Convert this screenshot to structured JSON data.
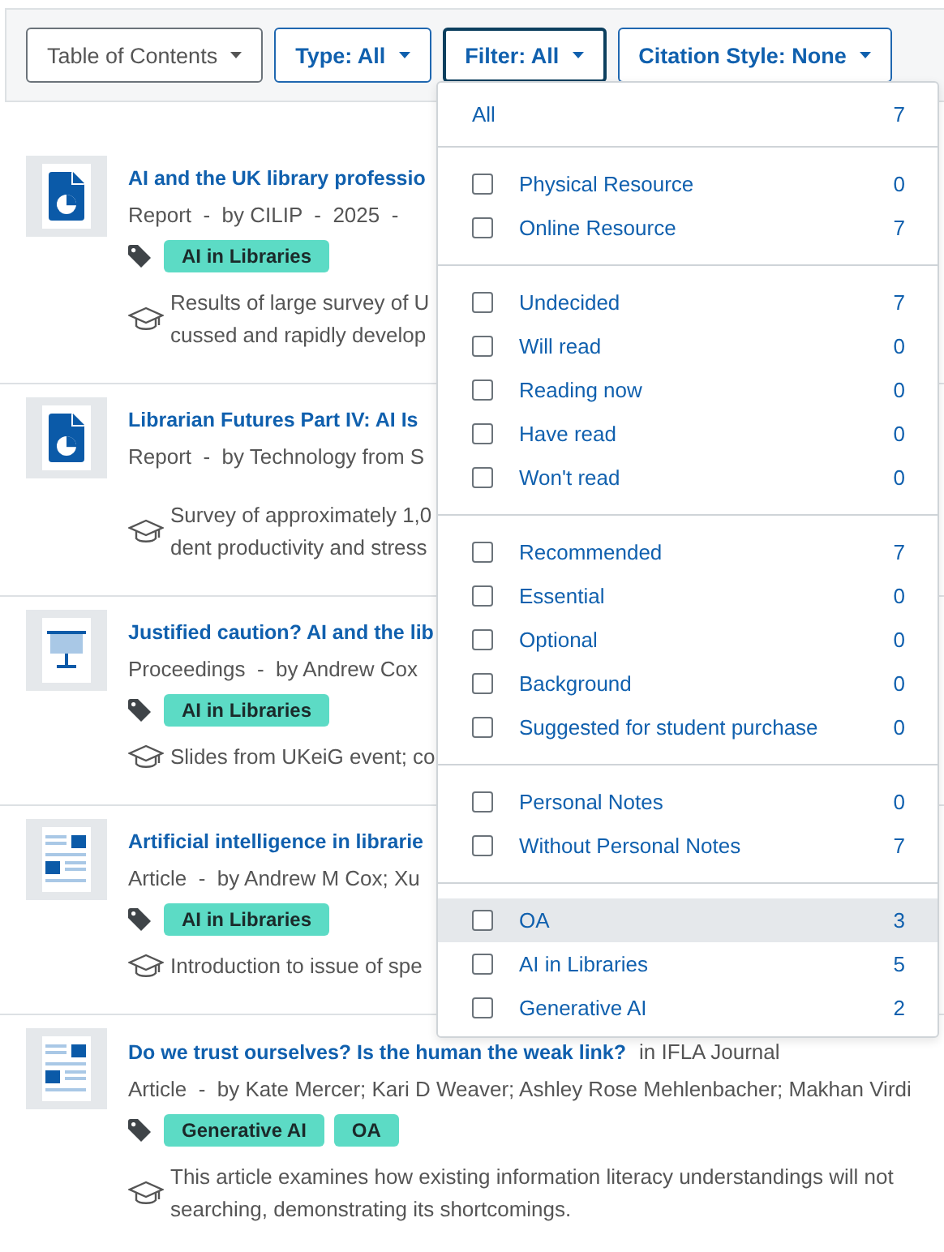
{
  "toolbar": {
    "buttons": [
      {
        "label": "Table of Contents",
        "kind": "plain",
        "open": false
      },
      {
        "label": "Type: All",
        "kind": "primary",
        "open": false
      },
      {
        "label": "Filter: All",
        "kind": "primary",
        "open": true
      },
      {
        "label": "Citation Style: None",
        "kind": "primary",
        "open": false
      }
    ]
  },
  "items": [
    {
      "kind": "report",
      "title": "AI and the UK library professio",
      "meta": "Report  -  by CILIP  -  2025  -",
      "tags": [
        {
          "label": "AI in Libraries"
        }
      ],
      "description": [
        "Results of large survey of U",
        "cussed and rapidly develop"
      ]
    },
    {
      "kind": "report",
      "title": "Librarian Futures Part IV: AI Is",
      "meta": "Report  -  by Technology from S",
      "description": [
        "Survey of approximately 1,0",
        "dent productivity and stress"
      ]
    },
    {
      "kind": "proceedings",
      "title": "Justified caution? AI and the lib",
      "meta": "Proceedings  -  by Andrew Cox",
      "tags": [
        {
          "label": "AI in Libraries"
        }
      ],
      "description": [
        "Slides from UKeiG event; co"
      ]
    },
    {
      "kind": "article",
      "title": "Artificial intelligence in librarie",
      "meta": "Article  -  by Andrew M Cox; Xu",
      "tags": [
        {
          "label": "AI in Libraries"
        }
      ],
      "description": [
        "Introduction to issue of spe"
      ]
    },
    {
      "kind": "article",
      "title": "Do we trust ourselves? Is the human the weak link?",
      "source": "in IFLA Journal",
      "meta": "Article  -  by Kate Mercer; Kari D Weaver; Ashley Rose Mehlenbacher; Makhan Virdi",
      "tags": [
        {
          "label": "Generative AI"
        },
        {
          "label": "OA"
        }
      ],
      "description": [
        "This article examines how existing information literacy understandings will not",
        "searching, demonstrating its shortcomings."
      ]
    }
  ],
  "filter_menu": {
    "all": {
      "label": "All",
      "count": "7"
    },
    "groups": [
      {
        "options": [
          {
            "label": "Physical Resource",
            "count": "0",
            "checked": false,
            "highlighted": false
          },
          {
            "label": "Online Resource",
            "count": "7",
            "checked": false,
            "highlighted": false
          }
        ]
      },
      {
        "options": [
          {
            "label": "Undecided",
            "count": "7",
            "checked": false,
            "highlighted": false
          },
          {
            "label": "Will read",
            "count": "0",
            "checked": false,
            "highlighted": false
          },
          {
            "label": "Reading now",
            "count": "0",
            "checked": false,
            "highlighted": false
          },
          {
            "label": "Have read",
            "count": "0",
            "checked": false,
            "highlighted": false
          },
          {
            "label": "Won't read",
            "count": "0",
            "checked": false,
            "highlighted": false
          }
        ]
      },
      {
        "options": [
          {
            "label": "Recommended",
            "count": "7",
            "checked": false,
            "highlighted": false
          },
          {
            "label": "Essential",
            "count": "0",
            "checked": false,
            "highlighted": false
          },
          {
            "label": "Optional",
            "count": "0",
            "checked": false,
            "highlighted": false
          },
          {
            "label": "Background",
            "count": "0",
            "checked": false,
            "highlighted": false
          },
          {
            "label": "Suggested for student purchase",
            "count": "0",
            "checked": false,
            "highlighted": false
          }
        ]
      },
      {
        "options": [
          {
            "label": "Personal Notes",
            "count": "0",
            "checked": false,
            "highlighted": false
          },
          {
            "label": "Without Personal Notes",
            "count": "7",
            "checked": false,
            "highlighted": false
          }
        ]
      },
      {
        "options": [
          {
            "label": "OA",
            "count": "3",
            "checked": false,
            "highlighted": true
          },
          {
            "label": "AI in Libraries",
            "count": "5",
            "checked": false,
            "highlighted": false
          },
          {
            "label": "Generative AI",
            "count": "2",
            "checked": false,
            "highlighted": false
          }
        ]
      }
    ]
  }
}
